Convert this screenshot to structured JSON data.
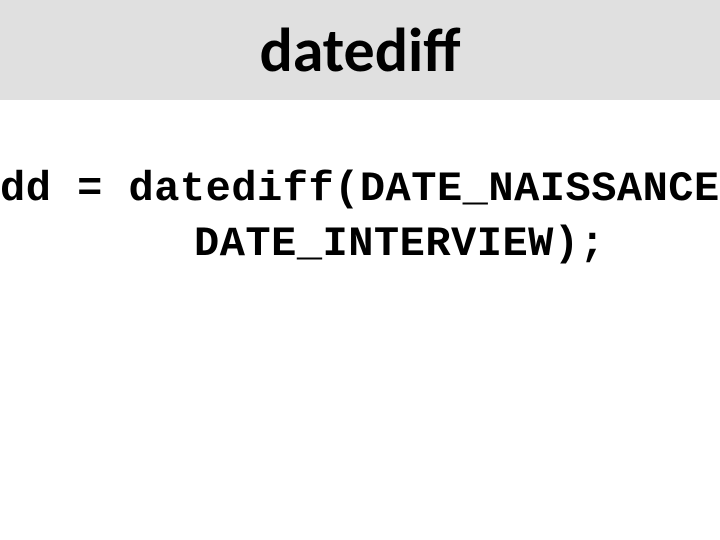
{
  "header": {
    "title": "datediff"
  },
  "code": {
    "line1": "dd = datediff(DATE_NAISSANCE,",
    "line2": "DATE_INTERVIEW);"
  }
}
